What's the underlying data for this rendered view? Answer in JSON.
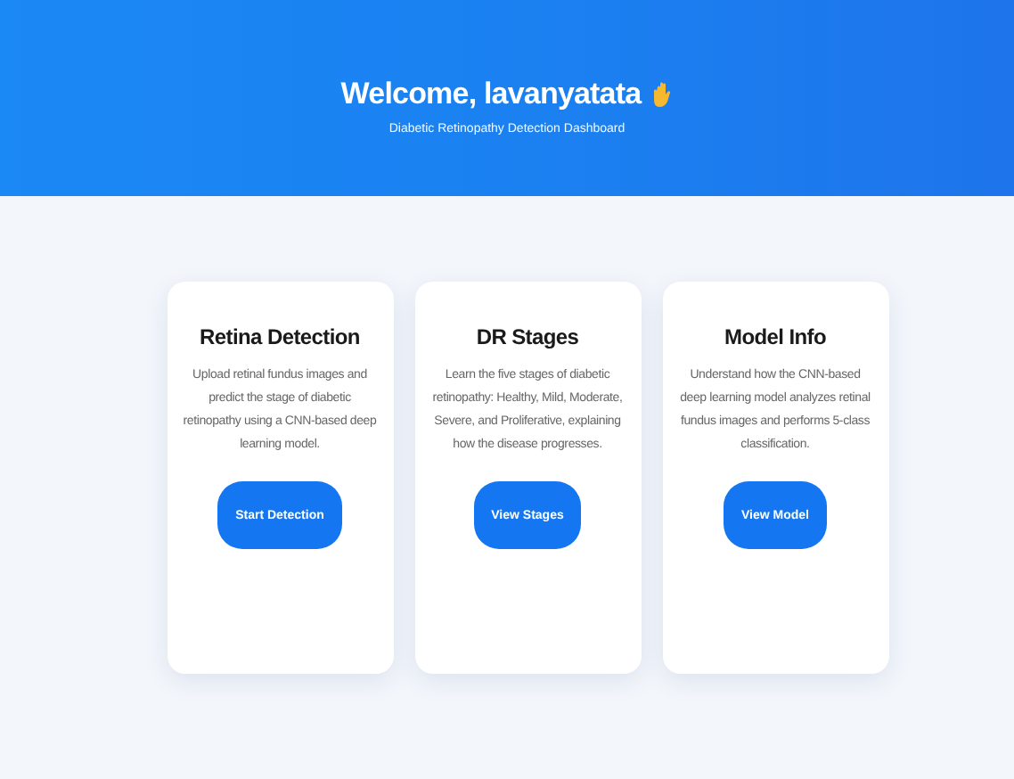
{
  "header": {
    "title": "Welcome, lavanyatata",
    "subtitle": "Diabetic Retinopathy Detection Dashboard"
  },
  "cards": [
    {
      "title": "Retina Detection",
      "description": "Upload retinal fundus images and predict the stage of diabetic retinopathy using a CNN-based deep learning model.",
      "button": "Start Detection"
    },
    {
      "title": "DR Stages",
      "description": "Learn the five stages of diabetic retinopathy: Healthy, Mild, Moderate, Severe, and Proliferative, explaining how the disease progresses.",
      "button": "View Stages"
    },
    {
      "title": "Model Info",
      "description": "Understand how the CNN-based deep learning model analyzes retinal fundus images and performs 5-class classification.",
      "button": "View Model"
    }
  ]
}
